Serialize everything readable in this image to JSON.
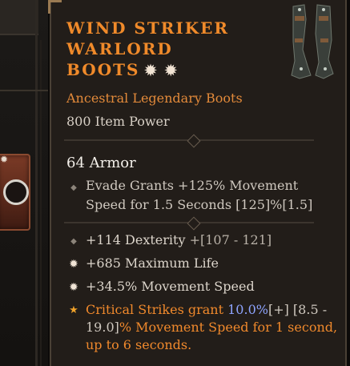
{
  "item": {
    "name_line1": "Wind Striker",
    "name_line2": "Warlord",
    "name_line3": "Boots",
    "name_stars": "✹ ✹",
    "subtype": "Ancestral Legendary Boots",
    "item_power": "800 Item Power",
    "armor": "64 Armor",
    "implicit": {
      "line1": "Evade Grants +125% Movement",
      "line2": "Speed for 1.5 Seconds [125]%[1.5]"
    },
    "affixes": [
      {
        "text": "+114 Dexterity",
        "range": " +[107 - 121]"
      },
      {
        "text": "+685 Maximum Life"
      },
      {
        "text": "+34.5% Movement Speed"
      }
    ],
    "legendary": {
      "part1": "Critical Strikes grant ",
      "value": "10.0%",
      "range1": "[+] [8.5 -",
      "range2": "19.0]",
      "part2": "% Movement Speed for 1 second,",
      "line3": "up to 6 seconds."
    }
  },
  "icons": {
    "implicit_bullet": "diamond-icon",
    "greater_affix": "burst-icon",
    "legendary_bullet": "star-icon"
  },
  "colors": {
    "title": "#f08a2a",
    "legendary_text": "#f0892c",
    "value_highlight": "#8ea4ff",
    "background": "#221d19"
  }
}
